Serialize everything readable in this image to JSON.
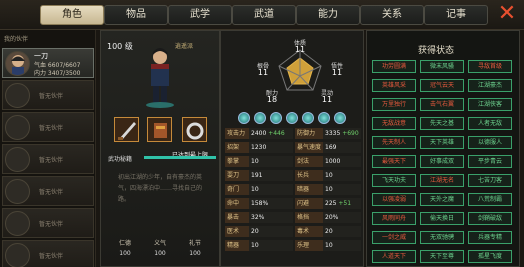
{
  "tabs": [
    "角色",
    "物品",
    "武学",
    "武道",
    "能力",
    "关系",
    "记事"
  ],
  "close_icon": "close-icon",
  "roster": {
    "title": "我的伙伴",
    "active": {
      "name": "一刀",
      "hp": "气血 6607/6607",
      "mp": "内力 3407/3500"
    },
    "empty_label": "暂无伙伴"
  },
  "character": {
    "level": "100 级",
    "sect": "逍遥派",
    "skill_label": "武功秘籍",
    "skill_max": "已达到最上限",
    "skill_progress": 1.0,
    "description": "初出江湖的少年，自有豪杰的英气，四海漂泊中……寻找自己的路。",
    "bottom_attrs": [
      {
        "label": "仁德",
        "value": "100"
      },
      {
        "label": "义气",
        "value": "100"
      },
      {
        "label": "礼节",
        "value": "100"
      }
    ]
  },
  "radar": {
    "labels": {
      "top": "体质",
      "left": "根骨",
      "right": "悟性",
      "bl": "耐力",
      "br": "灵动"
    },
    "values": {
      "top": "11",
      "left": "11",
      "right": "11",
      "bl": "18",
      "br": "11"
    }
  },
  "stats": [
    {
      "k": "攻击力",
      "v": "2400",
      "extra": "+446",
      "k2": "防御力",
      "v2": "3335",
      "extra2": "+690"
    },
    {
      "k": "招架",
      "v": "1230",
      "extra": "",
      "k2": "暴气速度",
      "v2": "169",
      "extra2": ""
    },
    {
      "k": "拳掌",
      "v": "10",
      "extra": "",
      "k2": "剑法",
      "v2": "1000",
      "extra2": ""
    },
    {
      "k": "耍刀",
      "v": "191",
      "extra": "",
      "k2": "长兵",
      "v2": "10",
      "extra2": ""
    },
    {
      "k": "奇门",
      "v": "10",
      "extra": "",
      "k2": "暗器",
      "v2": "10",
      "extra2": ""
    },
    {
      "k": "命中",
      "v": "158%",
      "extra": "",
      "k2": "闪避",
      "v2": "225",
      "extra2": "+51"
    },
    {
      "k": "暴击",
      "v": "32%",
      "extra": "",
      "k2": "格挡",
      "v2": "20%",
      "extra2": ""
    },
    {
      "k": "医术",
      "v": "20",
      "extra": "",
      "k2": "毒术",
      "v2": "20",
      "extra2": ""
    },
    {
      "k": "精器",
      "v": "10",
      "extra": "",
      "k2": "乐理",
      "v2": "10",
      "extra2": ""
    }
  ],
  "status_panel": {
    "title": "获得状态",
    "items": [
      "功劳圆满",
      "微末风骚",
      "寻敌首级",
      "英雄风采",
      "冠气云天",
      "江湖豪杰",
      "万里独行",
      "击气右翼",
      "江湖侠客",
      "无敌战意",
      "先天之基",
      "人者无敌",
      "先天制人",
      "天下英雄",
      "以德服人",
      "最强天下",
      "好事成双",
      "平步青云",
      "飞天功夫",
      "江湖无名",
      "七苦刀客",
      "以强凌弱",
      "天外之魔",
      "八荒制霸",
      "风雨同舟",
      "偷天换日",
      "剑鞘破敌",
      "一剑之威",
      "无双驰骋",
      "兵器专精",
      "人道天下",
      "天下至尊",
      "孤星飞度"
    ]
  }
}
